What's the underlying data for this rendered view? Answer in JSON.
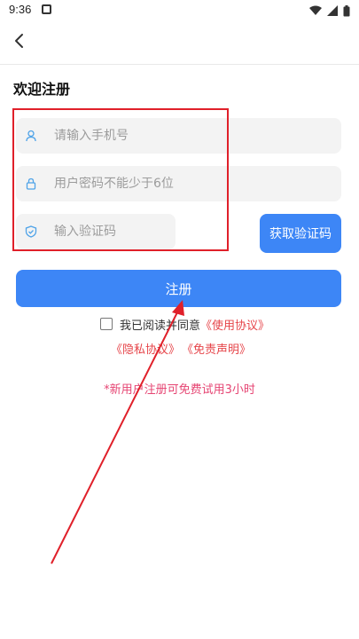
{
  "status_bar": {
    "time": "9:36"
  },
  "page": {
    "title": "欢迎注册"
  },
  "form": {
    "phone_placeholder": "请输入手机号",
    "password_placeholder": "用户密码不能少于6位",
    "code_placeholder": "输入验证码",
    "get_code_label": "获取验证码",
    "register_label": "注册"
  },
  "agreement": {
    "prefix": "我已阅读并同意",
    "terms_link": "《使用协议》",
    "privacy_link": "《隐私协议》",
    "disclaimer_link": "《免责声明》"
  },
  "promo_text": "*新用户注册可免费试用3小时",
  "colors": {
    "primary": "#3d86f6",
    "link": "#e6454a",
    "promo": "#e64573",
    "annotation": "#e0202a"
  }
}
